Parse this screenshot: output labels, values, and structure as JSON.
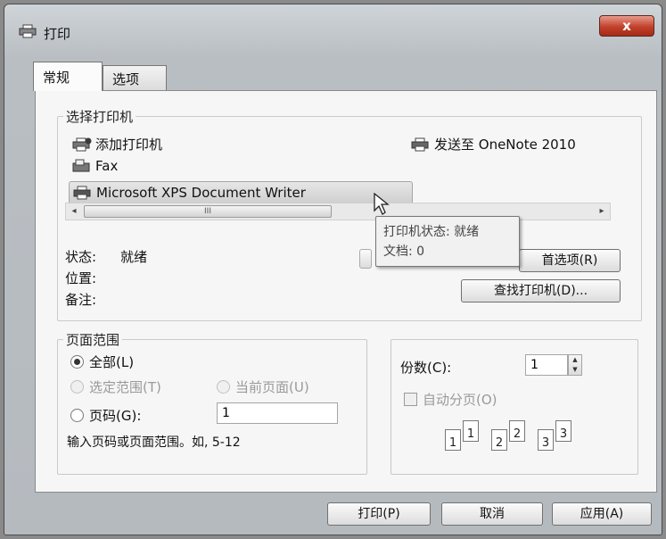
{
  "window": {
    "title": "打印",
    "close_label": "x"
  },
  "tabs": [
    "常规",
    "选项"
  ],
  "select_printer": {
    "group_title": "选择打印机",
    "printers": [
      {
        "name": "添加打印机",
        "icon": "add-printer-icon"
      },
      {
        "name": "Fax",
        "icon": "fax-icon"
      },
      {
        "name": "Microsoft XPS Document Writer",
        "icon": "printer-icon",
        "selected": true
      },
      {
        "name": "发送至 OneNote 2010",
        "icon": "printer-icon"
      }
    ],
    "scroll_thumb_label": "III",
    "status_label": "状态:",
    "status_value": "就绪",
    "location_label": "位置:",
    "comment_label": "备注:",
    "preferences_button": "首选项(R)",
    "find_printer_button": "查找打印机(D)..."
  },
  "tooltip": {
    "line1": "打印机状态: 就绪",
    "line2": "文档: 0"
  },
  "page_range": {
    "group_title": "页面范围",
    "all_label": "全部(L)",
    "selection_label": "选定范围(T)",
    "current_page_label": "当前页面(U)",
    "pages_label": "页码(G):",
    "pages_value": "1",
    "hint": "输入页码或页面范围。如, 5-12"
  },
  "copies": {
    "copies_label": "份数(C):",
    "copies_value": "1",
    "collate_label": "自动分页(O)",
    "collate_pages": [
      "1",
      "1",
      "2",
      "2",
      "3",
      "3"
    ]
  },
  "footer": {
    "print_button": "打印(P)",
    "cancel_button": "取消",
    "apply_button": "应用(A)"
  }
}
